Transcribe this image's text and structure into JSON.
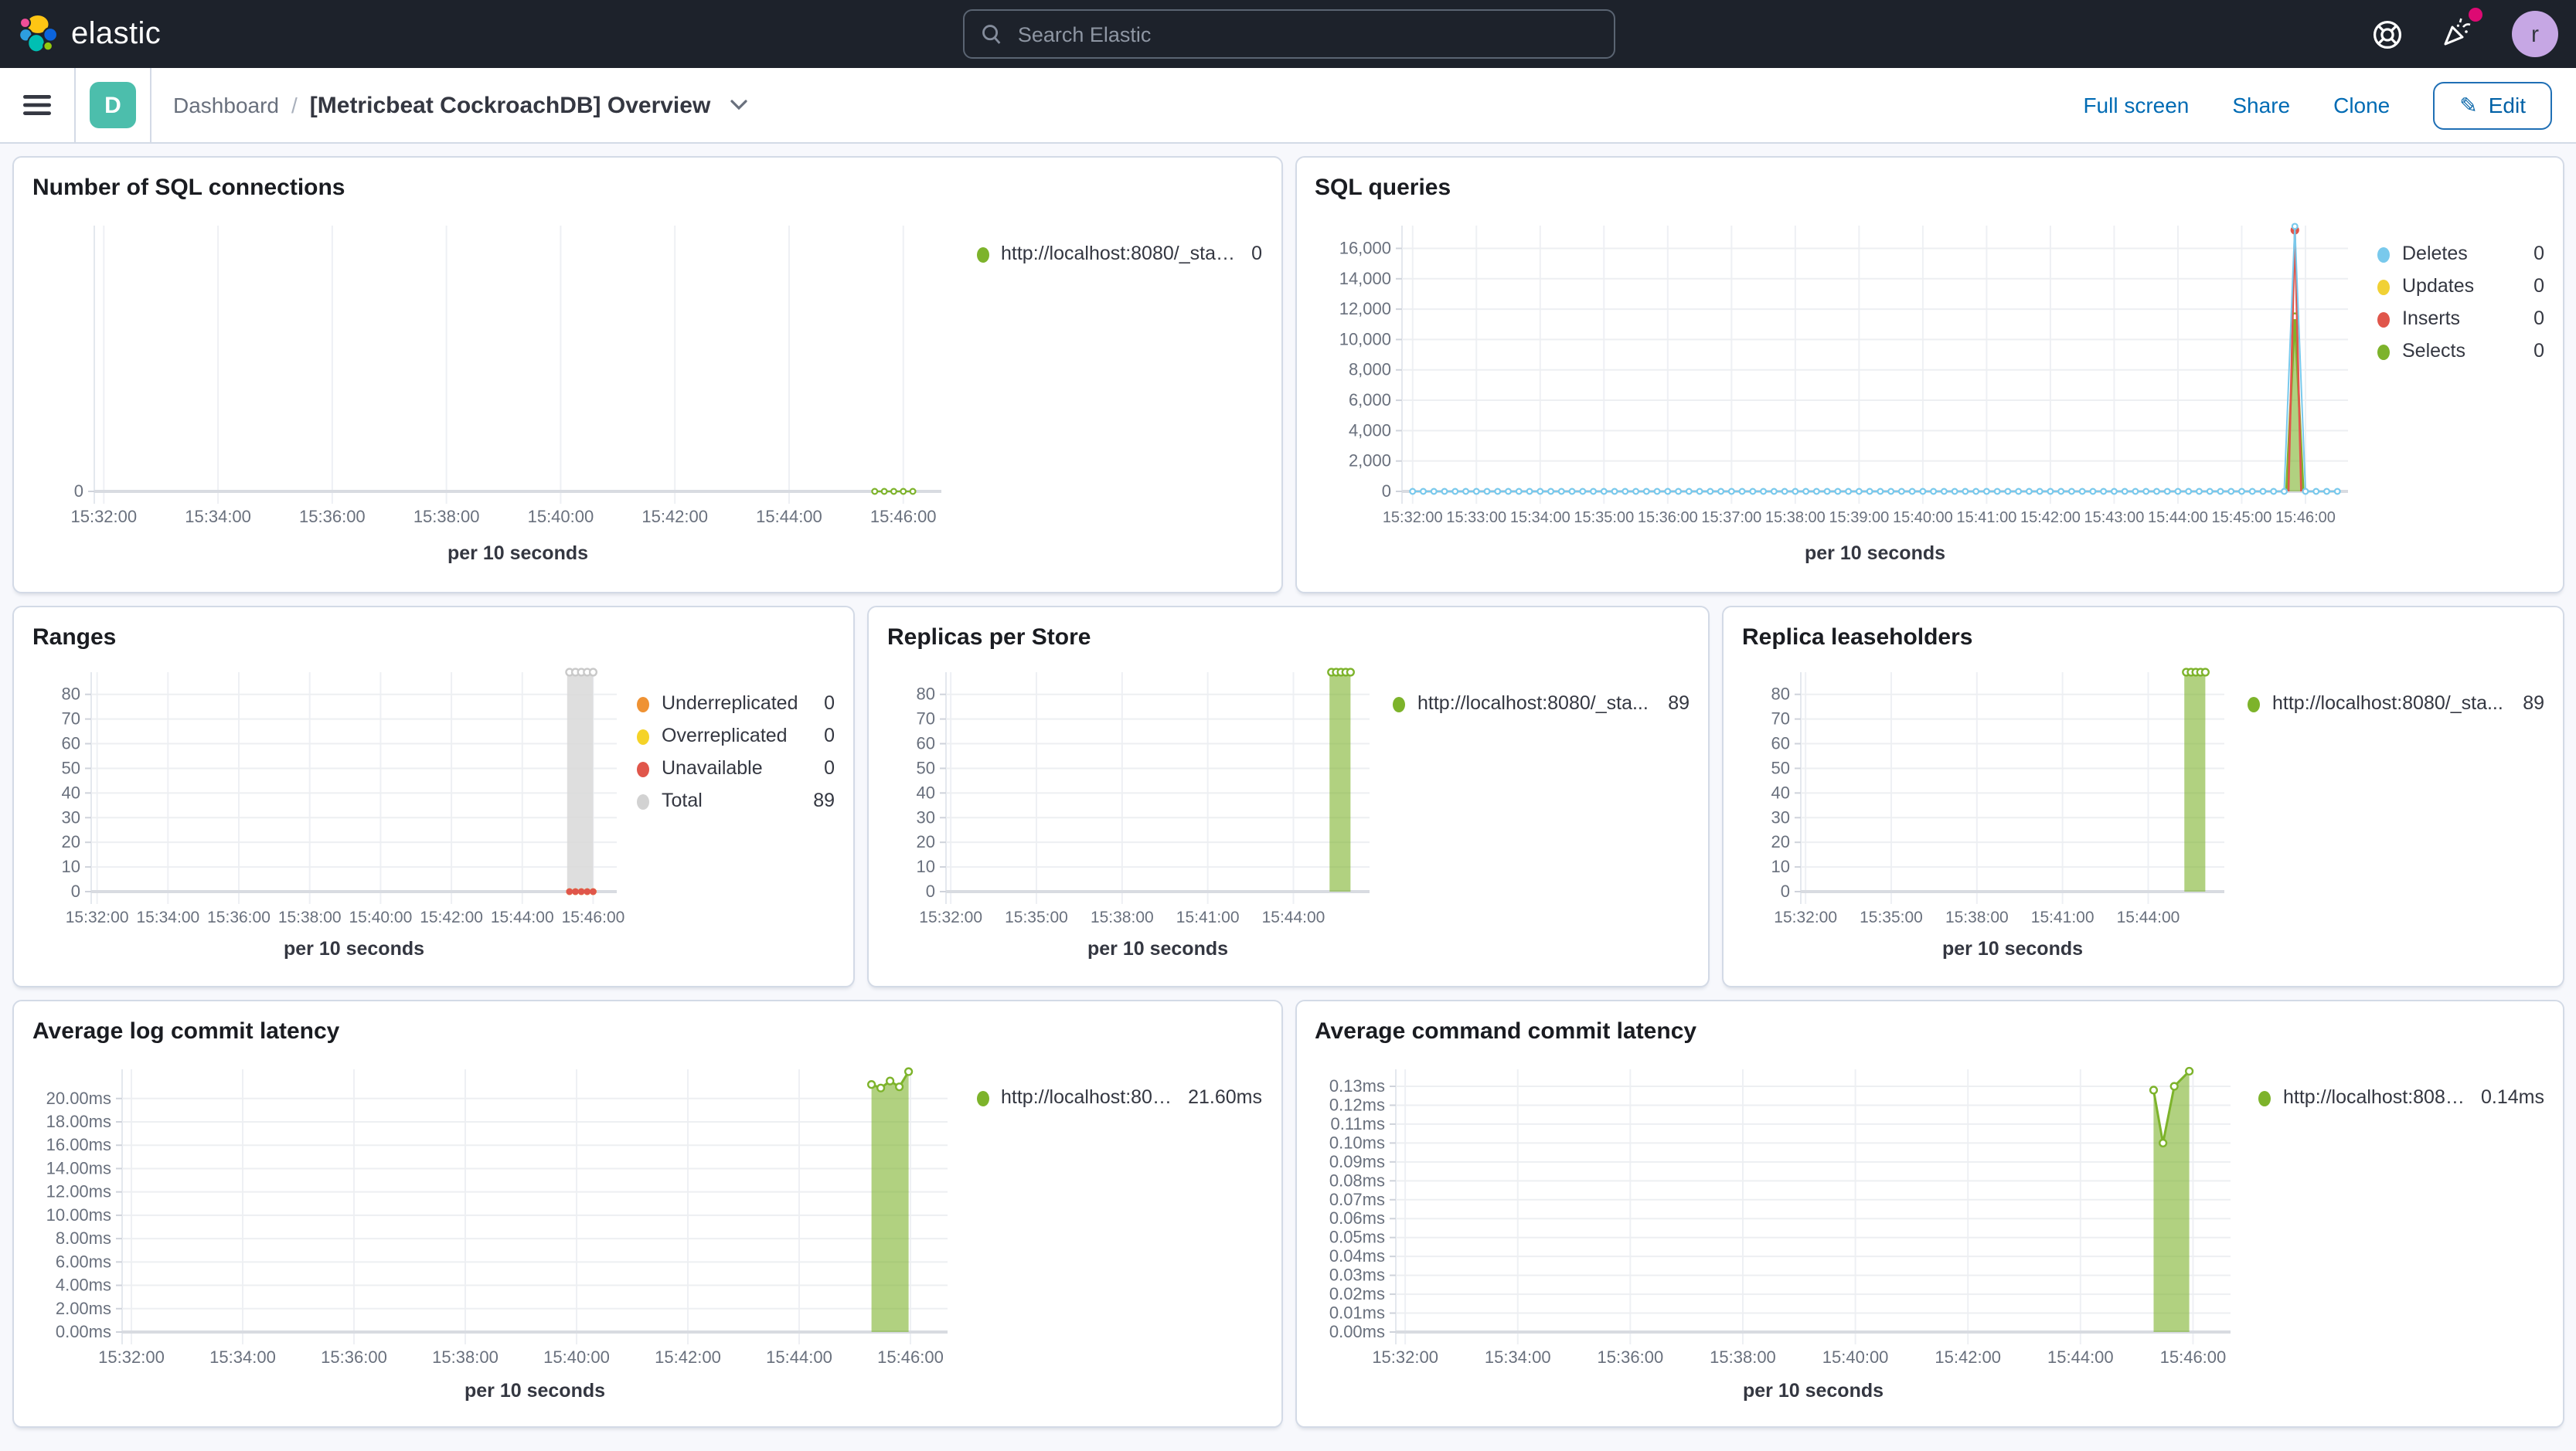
{
  "topbar": {
    "brand": "elastic",
    "search_placeholder": "Search Elastic",
    "avatar_initial": "r",
    "notification_color": "#DD0A73"
  },
  "navbar": {
    "dashboard_badge": "D",
    "breadcrumb_root": "Dashboard",
    "breadcrumb_separator": "/",
    "page_title": "[Metricbeat CockroachDB] Overview",
    "actions": {
      "full_screen": "Full screen",
      "share": "Share",
      "clone": "Clone",
      "edit": "Edit"
    }
  },
  "charts": [
    {
      "title": "Number of SQL connections",
      "chart_data": {
        "type": "line",
        "title": "Number of SQL connections",
        "xlabel": "per 10 seconds",
        "xlim": [
          "15:31:50",
          "15:46:40"
        ],
        "ylim": [
          0,
          1
        ],
        "x_ticks": [
          "15:32:00",
          "15:34:00",
          "15:36:00",
          "15:38:00",
          "15:40:00",
          "15:42:00",
          "15:44:00",
          "15:46:00"
        ],
        "y_ticks": [
          [
            0,
            "0"
          ]
        ],
        "legend": [
          {
            "label": "http://localhost:8080/_stat...",
            "value": "0",
            "color": "#7DB32B"
          }
        ],
        "series": [
          {
            "name": "http://localhost:8080/_stat...",
            "color": "#7DB32B",
            "style": "dotline",
            "span": {
              "from": "15:45:30",
              "to": "15:46:10",
              "every_s": 10,
              "value": 0
            }
          }
        ]
      }
    },
    {
      "title": "SQL queries",
      "chart_data": {
        "type": "line",
        "title": "SQL queries",
        "xlabel": "per 10 seconds",
        "xlim": [
          "15:31:50",
          "15:46:40"
        ],
        "ylim": [
          0,
          17500
        ],
        "x_ticks": [
          "15:32:00",
          "15:33:00",
          "15:34:00",
          "15:35:00",
          "15:36:00",
          "15:37:00",
          "15:38:00",
          "15:39:00",
          "15:40:00",
          "15:41:00",
          "15:42:00",
          "15:43:00",
          "15:44:00",
          "15:45:00",
          "15:46:00"
        ],
        "y_ticks": [
          [
            0,
            "0"
          ],
          [
            2000,
            "2,000"
          ],
          [
            4000,
            "4,000"
          ],
          [
            6000,
            "6,000"
          ],
          [
            8000,
            "8,000"
          ],
          [
            10000,
            "10,000"
          ],
          [
            12000,
            "12,000"
          ],
          [
            14000,
            "14,000"
          ],
          [
            16000,
            "16,000"
          ]
        ],
        "legend": [
          {
            "label": "Deletes",
            "value": "0",
            "color": "#79C9EC"
          },
          {
            "label": "Updates",
            "value": "0",
            "color": "#F1D135"
          },
          {
            "label": "Inserts",
            "value": "0",
            "color": "#E0564B"
          },
          {
            "label": "Selects",
            "value": "0",
            "color": "#7DB32B"
          }
        ],
        "series": [
          {
            "name": "Updates",
            "color": "#F1D135",
            "style": "line",
            "points": []
          },
          {
            "name": "Selects",
            "color": "#7DB32B",
            "style": "area",
            "fill_opacity": 0.6,
            "points": [
              [
                "15:45:42",
                0
              ],
              [
                "15:45:50",
                11500
              ],
              [
                "15:45:58",
                0
              ]
            ],
            "marker_points": [
              [
                "15:45:50",
                11500
              ]
            ]
          },
          {
            "name": "Inserts",
            "color": "#E0564B",
            "style": "line",
            "points": [
              [
                "15:45:44",
                0
              ],
              [
                "15:45:50",
                17200
              ],
              [
                "15:45:56",
                0
              ]
            ],
            "marker_points": [
              [
                "15:45:50",
                17200
              ]
            ]
          },
          {
            "name": "Deletes",
            "color": "#79C9EC",
            "style": "dotline",
            "span": {
              "from": "15:32:00",
              "to": "15:46:30",
              "every_s": 10,
              "value": 0
            },
            "points": [
              [
                "15:45:50",
                17450
              ]
            ]
          }
        ]
      }
    },
    {
      "title": "Ranges",
      "chart_data": {
        "type": "area",
        "title": "Ranges",
        "xlabel": "per 10 seconds",
        "xlim": [
          "15:31:50",
          "15:46:40"
        ],
        "ylim": [
          0,
          89
        ],
        "x_ticks": [
          "15:32:00",
          "15:34:00",
          "15:36:00",
          "15:38:00",
          "15:40:00",
          "15:42:00",
          "15:44:00",
          "15:46:00"
        ],
        "y_ticks": [
          [
            0,
            "0"
          ],
          [
            10,
            "10"
          ],
          [
            20,
            "20"
          ],
          [
            30,
            "30"
          ],
          [
            40,
            "40"
          ],
          [
            50,
            "50"
          ],
          [
            60,
            "60"
          ],
          [
            70,
            "70"
          ],
          [
            80,
            "80"
          ]
        ],
        "legend": [
          {
            "label": "Underreplicated",
            "value": "0",
            "color": "#EF9233"
          },
          {
            "label": "Overreplicated",
            "value": "0",
            "color": "#F5D328"
          },
          {
            "label": "Unavailable",
            "value": "0",
            "color": "#E0564B"
          },
          {
            "label": "Total",
            "value": "89",
            "color": "#D2D2D2"
          }
        ],
        "series": [
          {
            "name": "Total",
            "color": "#C9C9C9",
            "fill": "#D8D8D8",
            "style": "area",
            "fill_opacity": 0.85,
            "points": [
              [
                "15:45:16",
                89
              ],
              [
                "15:45:20",
                89
              ],
              [
                "15:45:30",
                89
              ],
              [
                "15:45:40",
                89
              ],
              [
                "15:45:50",
                89
              ],
              [
                "15:46:00",
                89
              ]
            ],
            "marker_points": [
              [
                "15:45:20",
                89
              ],
              [
                "15:45:30",
                89
              ],
              [
                "15:45:40",
                89
              ],
              [
                "15:45:50",
                89
              ],
              [
                "15:46:00",
                89
              ]
            ]
          },
          {
            "name": "Underreplicated",
            "color": "#EF9233",
            "style": "dots",
            "points": [
              [
                "15:45:20",
                0
              ],
              [
                "15:45:30",
                0
              ],
              [
                "15:45:40",
                0
              ],
              [
                "15:45:50",
                0
              ],
              [
                "15:46:00",
                0
              ]
            ]
          },
          {
            "name": "Overreplicated",
            "color": "#F5D328",
            "style": "dots",
            "points": [
              [
                "15:45:20",
                0
              ],
              [
                "15:45:30",
                0
              ],
              [
                "15:45:40",
                0
              ],
              [
                "15:45:50",
                0
              ],
              [
                "15:46:00",
                0
              ]
            ]
          },
          {
            "name": "Unavailable",
            "color": "#E0564B",
            "style": "dots",
            "points": [
              [
                "15:45:20",
                0
              ],
              [
                "15:45:30",
                0
              ],
              [
                "15:45:40",
                0
              ],
              [
                "15:45:50",
                0
              ],
              [
                "15:46:00",
                0
              ]
            ]
          }
        ]
      }
    },
    {
      "title": "Replicas per Store",
      "chart_data": {
        "type": "area",
        "title": "Replicas per Store",
        "xlabel": "per 10 seconds",
        "xlim": [
          "15:31:50",
          "15:46:40"
        ],
        "ylim": [
          0,
          89
        ],
        "x_ticks": [
          "15:32:00",
          "15:35:00",
          "15:38:00",
          "15:41:00",
          "15:44:00"
        ],
        "y_ticks": [
          [
            0,
            "0"
          ],
          [
            10,
            "10"
          ],
          [
            20,
            "20"
          ],
          [
            30,
            "30"
          ],
          [
            40,
            "40"
          ],
          [
            50,
            "50"
          ],
          [
            60,
            "60"
          ],
          [
            70,
            "70"
          ],
          [
            80,
            "80"
          ]
        ],
        "legend": [
          {
            "label": "http://localhost:8080/_sta...",
            "value": "89",
            "color": "#7DB32B"
          }
        ],
        "series": [
          {
            "name": "http://localhost:8080/_sta...",
            "color": "#7DB32B",
            "style": "area",
            "fill_opacity": 0.6,
            "points": [
              [
                "15:45:16",
                89
              ],
              [
                "15:45:20",
                89
              ],
              [
                "15:45:30",
                89
              ],
              [
                "15:45:40",
                89
              ],
              [
                "15:45:50",
                89
              ],
              [
                "15:46:00",
                89
              ]
            ],
            "marker_points": [
              [
                "15:45:20",
                89
              ],
              [
                "15:45:30",
                89
              ],
              [
                "15:45:40",
                89
              ],
              [
                "15:45:50",
                89
              ],
              [
                "15:46:00",
                89
              ]
            ]
          }
        ]
      }
    },
    {
      "title": "Replica leaseholders",
      "chart_data": {
        "type": "area",
        "title": "Replica leaseholders",
        "xlabel": "per 10 seconds",
        "xlim": [
          "15:31:50",
          "15:46:40"
        ],
        "ylim": [
          0,
          89
        ],
        "x_ticks": [
          "15:32:00",
          "15:35:00",
          "15:38:00",
          "15:41:00",
          "15:44:00"
        ],
        "y_ticks": [
          [
            0,
            "0"
          ],
          [
            10,
            "10"
          ],
          [
            20,
            "20"
          ],
          [
            30,
            "30"
          ],
          [
            40,
            "40"
          ],
          [
            50,
            "50"
          ],
          [
            60,
            "60"
          ],
          [
            70,
            "70"
          ],
          [
            80,
            "80"
          ]
        ],
        "legend": [
          {
            "label": "http://localhost:8080/_sta...",
            "value": "89",
            "color": "#7DB32B"
          }
        ],
        "series": [
          {
            "name": "http://localhost:8080/_sta...",
            "color": "#7DB32B",
            "style": "area",
            "fill_opacity": 0.6,
            "points": [
              [
                "15:45:16",
                89
              ],
              [
                "15:45:20",
                89
              ],
              [
                "15:45:30",
                89
              ],
              [
                "15:45:40",
                89
              ],
              [
                "15:45:50",
                89
              ],
              [
                "15:46:00",
                89
              ]
            ],
            "marker_points": [
              [
                "15:45:20",
                89
              ],
              [
                "15:45:30",
                89
              ],
              [
                "15:45:40",
                89
              ],
              [
                "15:45:50",
                89
              ],
              [
                "15:46:00",
                89
              ]
            ]
          }
        ]
      }
    },
    {
      "title": "Average log commit latency",
      "chart_data": {
        "type": "area",
        "title": "Average log commit latency",
        "xlabel": "per 10 seconds",
        "xlim": [
          "15:31:50",
          "15:46:40"
        ],
        "ylim": [
          0,
          22.5
        ],
        "x_ticks": [
          "15:32:00",
          "15:34:00",
          "15:36:00",
          "15:38:00",
          "15:40:00",
          "15:42:00",
          "15:44:00",
          "15:46:00"
        ],
        "y_ticks": [
          [
            0,
            "0.00ms"
          ],
          [
            2,
            "2.00ms"
          ],
          [
            4,
            "4.00ms"
          ],
          [
            6,
            "6.00ms"
          ],
          [
            8,
            "8.00ms"
          ],
          [
            10,
            "10.00ms"
          ],
          [
            12,
            "12.00ms"
          ],
          [
            14,
            "14.00ms"
          ],
          [
            16,
            "16.00ms"
          ],
          [
            18,
            "18.00ms"
          ],
          [
            20,
            "20.00ms"
          ]
        ],
        "legend": [
          {
            "label": "http://localhost:808...",
            "value": "21.60ms",
            "color": "#7DB32B"
          }
        ],
        "series": [
          {
            "name": "http://localhost:808...",
            "color": "#7DB32B",
            "style": "area",
            "fill_opacity": 0.6,
            "points": [
              [
                "15:45:18",
                21.2
              ],
              [
                "15:45:28",
                20.9
              ],
              [
                "15:45:38",
                21.5
              ],
              [
                "15:45:48",
                21.0
              ],
              [
                "15:45:58",
                22.3
              ]
            ],
            "marker_points": [
              [
                "15:45:18",
                21.2
              ],
              [
                "15:45:28",
                20.9
              ],
              [
                "15:45:38",
                21.5
              ],
              [
                "15:45:48",
                21.0
              ],
              [
                "15:45:58",
                22.3
              ]
            ]
          }
        ]
      }
    },
    {
      "title": "Average command commit latency",
      "chart_data": {
        "type": "area",
        "title": "Average command commit latency",
        "xlabel": "per 10 seconds",
        "xlim": [
          "15:31:50",
          "15:46:40"
        ],
        "ylim": [
          0,
          0.139
        ],
        "x_ticks": [
          "15:32:00",
          "15:34:00",
          "15:36:00",
          "15:38:00",
          "15:40:00",
          "15:42:00",
          "15:44:00",
          "15:46:00"
        ],
        "y_ticks": [
          [
            0,
            "0.00ms"
          ],
          [
            0.01,
            "0.01ms"
          ],
          [
            0.02,
            "0.02ms"
          ],
          [
            0.03,
            "0.03ms"
          ],
          [
            0.04,
            "0.04ms"
          ],
          [
            0.05,
            "0.05ms"
          ],
          [
            0.06,
            "0.06ms"
          ],
          [
            0.07,
            "0.07ms"
          ],
          [
            0.08,
            "0.08ms"
          ],
          [
            0.09,
            "0.09ms"
          ],
          [
            0.1,
            "0.10ms"
          ],
          [
            0.11,
            "0.11ms"
          ],
          [
            0.12,
            "0.12ms"
          ],
          [
            0.13,
            "0.13ms"
          ]
        ],
        "legend": [
          {
            "label": "http://localhost:8080...",
            "value": "0.14ms",
            "color": "#7DB32B"
          }
        ],
        "series": [
          {
            "name": "http://localhost:8080...",
            "color": "#7DB32B",
            "style": "area",
            "fill_opacity": 0.6,
            "points": [
              [
                "15:45:18",
                0.128
              ],
              [
                "15:45:28",
                0.1
              ],
              [
                "15:45:40",
                0.13
              ],
              [
                "15:45:56",
                0.138
              ]
            ],
            "marker_points": [
              [
                "15:45:18",
                0.128
              ],
              [
                "15:45:28",
                0.1
              ],
              [
                "15:45:40",
                0.13
              ],
              [
                "15:45:56",
                0.138
              ]
            ]
          }
        ]
      }
    }
  ]
}
